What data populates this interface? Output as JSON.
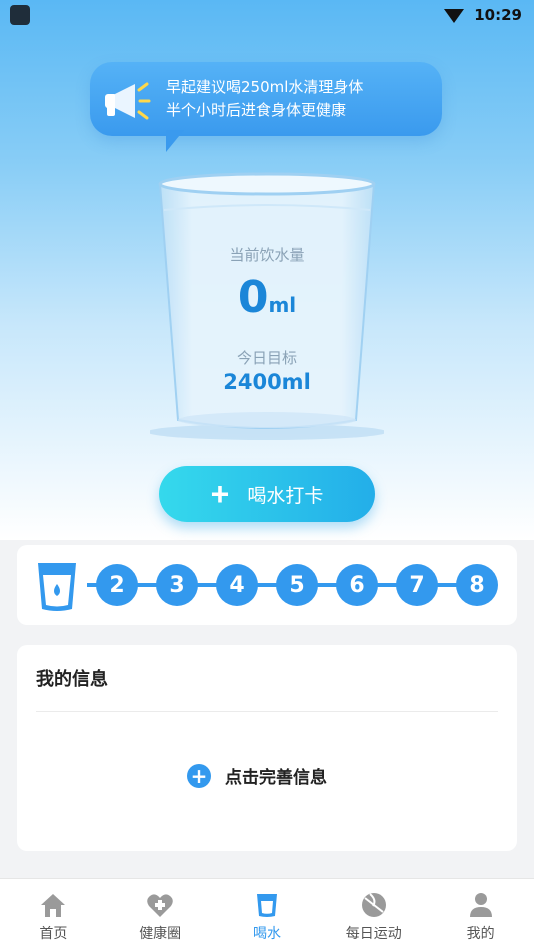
{
  "status_bar": {
    "time": "10:29"
  },
  "tip": {
    "line1": "早起建议喝250ml水清理身体",
    "line2": "半个小时后进食身体更健康"
  },
  "glass": {
    "current_label": "当前饮水量",
    "current_value": "0",
    "current_unit": "ml",
    "target_label": "今日目标",
    "target_value": "2400ml"
  },
  "checkin_button": {
    "label": "喝水打卡"
  },
  "progress": {
    "steps": [
      "2",
      "3",
      "4",
      "5",
      "6",
      "7",
      "8"
    ],
    "colors": {
      "accent": "#3399ee"
    }
  },
  "my_info": {
    "title": "我的信息",
    "complete_label": "点击完善信息"
  },
  "tabbar": {
    "items": [
      {
        "label": "首页",
        "icon": "home-icon"
      },
      {
        "label": "健康圈",
        "icon": "heart-plus-icon"
      },
      {
        "label": "喝水",
        "icon": "water-cup-icon",
        "active": true
      },
      {
        "label": "每日运动",
        "icon": "ball-icon"
      },
      {
        "label": "我的",
        "icon": "person-icon"
      }
    ]
  }
}
